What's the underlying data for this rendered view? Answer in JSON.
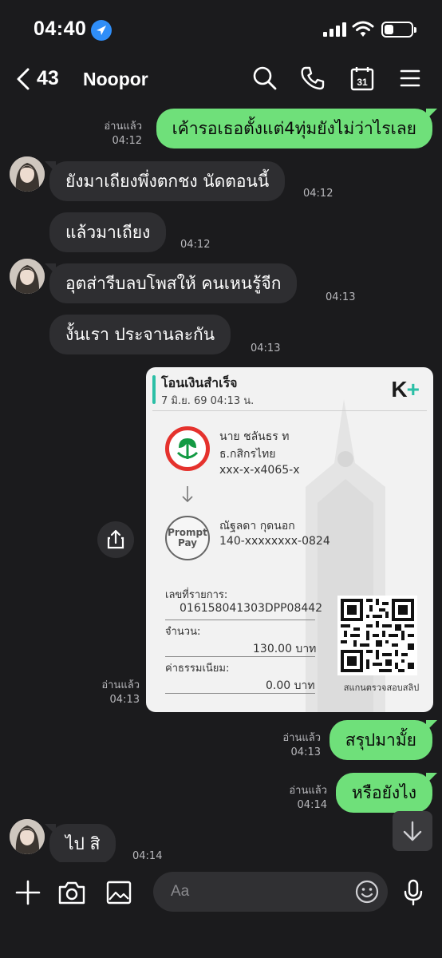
{
  "status_bar": {
    "time": "04:40"
  },
  "header": {
    "unread_count": "43",
    "contact_name": "Noopor",
    "calendar_day": "31"
  },
  "messages": [
    {
      "text": "เค้ารอเธอตั้งแต่4ทุ่มยังไม่ว่าไรเลย",
      "read": "อ่านแล้ว",
      "time": "04:12"
    },
    {
      "text": "ยังมาเถียงพึ่งตกชง นัดตอนนี้",
      "time": "04:12"
    },
    {
      "text": "แล้วมาเถียง",
      "time": "04:12"
    },
    {
      "text": "อุตส่ารีบลบโพสให้  คนเหนรู้จีก",
      "time": "04:13"
    },
    {
      "text": "งั้นเรา   ประจานละกัน",
      "time": "04:13"
    },
    {
      "read": "อ่านแล้ว",
      "time": "04:13"
    },
    {
      "text": "สรุปมามั้ย",
      "read": "อ่านแล้ว",
      "time": "04:13"
    },
    {
      "text": "หรือยังไง",
      "read": "อ่านแล้ว",
      "time": "04:14"
    },
    {
      "text": "ไป  สิ",
      "time": "04:14"
    }
  ],
  "slip": {
    "title": "โอนเงินสำเร็จ",
    "date": "7 มิ.ย. 69  04:13 น.",
    "brand_k": "K",
    "brand_plus": "+",
    "sender_name": "นาย ชลันธร ท",
    "sender_bank": "ธ.กสิกรไทย",
    "sender_account": "xxx-x-x4065-x",
    "promptpay_logo_line1": "Prompt",
    "promptpay_logo_line2": "Pay",
    "receiver_name": "ณัฐลดา กุดนอก",
    "receiver_account": "140-xxxxxxxx-0824",
    "ref_label": "เลขที่รายการ:",
    "ref_value": "016158041303DPP08442",
    "amount_label": "จำนวน:",
    "amount_value": "130.00 บาท",
    "fee_label": "ค่าธรรมเนียม:",
    "fee_value": "0.00 บาท",
    "qr_caption": "สแกนตรวจสอบสลิป"
  },
  "input": {
    "placeholder": "Aa"
  },
  "colors": {
    "outgoing_bubble": "#6fe07a",
    "incoming_bubble": "#2e2e31",
    "background": "#1b1b1d",
    "location_blue": "#2f8ef8",
    "kplus_green": "#2bbfa6",
    "kbank_red": "#e5322d"
  }
}
